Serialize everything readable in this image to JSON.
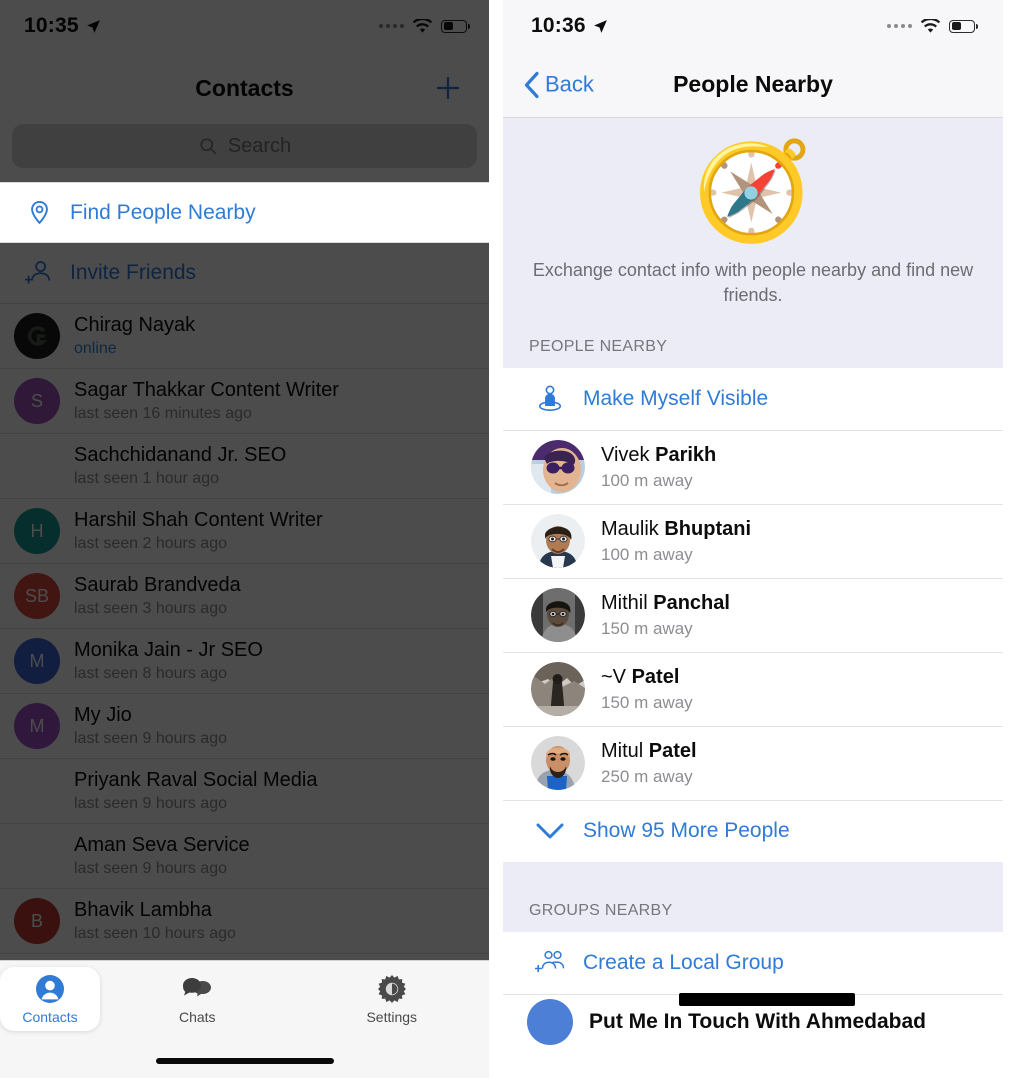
{
  "left": {
    "status": {
      "time": "10:35",
      "location_icon": "location-arrow-icon",
      "signal": "signal-dots-icon",
      "wifi": "wifi-icon",
      "battery": "battery-icon"
    },
    "nav": {
      "title": "Contacts",
      "add_button": "add-icon"
    },
    "search": {
      "placeholder": "Search",
      "icon": "search-icon"
    },
    "actions": [
      {
        "label": "Find People Nearby",
        "icon": "location-pin-icon",
        "highlighted": true
      },
      {
        "label": "Invite Friends",
        "icon": "person-add-icon",
        "highlighted": false
      }
    ],
    "contacts": [
      {
        "name": "Chirag Nayak",
        "status": "online",
        "online": true,
        "initials": "",
        "color": "#1b1b1b"
      },
      {
        "name": "Sagar Thakkar Content Writer",
        "status": "last seen 16 minutes ago",
        "online": false,
        "initials": "S",
        "color": "#a251bd"
      },
      {
        "name": "Sachchidanand Jr. SEO",
        "status": "last seen 1 hour ago",
        "online": false,
        "initials": "",
        "color": "transparent"
      },
      {
        "name": "Harshil Shah Content Writer",
        "status": "last seen 2 hours ago",
        "online": false,
        "initials": "H",
        "color": "#179a94"
      },
      {
        "name": "Saurab Brandveda",
        "status": "last seen 3 hours ago",
        "online": false,
        "initials": "SB",
        "color": "#d94a3d"
      },
      {
        "name": "Monika Jain - Jr SEO",
        "status": "last seen 8 hours ago",
        "online": false,
        "initials": "M",
        "color": "#3a64d8"
      },
      {
        "name": "My Jio",
        "status": "last seen 9 hours ago",
        "online": false,
        "initials": "M",
        "color": "#a252c9"
      },
      {
        "name": "Priyank Raval Social Media",
        "status": "last seen 9 hours ago",
        "online": false,
        "initials": "",
        "color": "transparent"
      },
      {
        "name": "Aman Seva Service",
        "status": "last seen 9 hours ago",
        "online": false,
        "initials": "",
        "color": "transparent"
      },
      {
        "name": "Bhavik Lambha",
        "status": "last seen 10 hours ago",
        "online": false,
        "initials": "B",
        "color": "#c33b30"
      }
    ],
    "tabbar": [
      {
        "label": "Contacts",
        "icon": "person-circle-icon",
        "active": true
      },
      {
        "label": "Chats",
        "icon": "chat-bubbles-icon",
        "active": false
      },
      {
        "label": "Settings",
        "icon": "gear-icon",
        "active": false
      }
    ]
  },
  "right": {
    "status": {
      "time": "10:36",
      "location_icon": "location-arrow-icon",
      "signal": "signal-dots-icon",
      "wifi": "wifi-icon",
      "battery": "battery-icon"
    },
    "nav": {
      "back_label": "Back",
      "back_icon": "chevron-left-icon",
      "title": "People Nearby"
    },
    "hero": {
      "icon": "compass-icon",
      "glyph": "🧭",
      "description": "Exchange contact info with people nearby and find new friends."
    },
    "people_section": {
      "header": "PEOPLE NEARBY",
      "visible_action": {
        "label": "Make Myself Visible",
        "icon": "person-on-platform-icon"
      },
      "people": [
        {
          "first": "Vivek ",
          "last": "Parikh",
          "distance": "100 m away",
          "avatar": "photo-vivek"
        },
        {
          "first": "Maulik ",
          "last": "Bhuptani",
          "distance": "100 m away",
          "avatar": "photo-maulik"
        },
        {
          "first": "Mithil ",
          "last": "Panchal",
          "distance": "150 m away",
          "avatar": "photo-mithil"
        },
        {
          "first": "~V ",
          "last": "Patel",
          "distance": "150 m away",
          "avatar": "photo-vpatel"
        },
        {
          "first": "Mitul ",
          "last": "Patel",
          "distance": "250 m away",
          "avatar": "photo-mitul"
        }
      ],
      "show_more": {
        "label": "Show 95 More People",
        "icon": "chevron-down-icon",
        "count": 95
      }
    },
    "groups_section": {
      "header": "GROUPS NEARBY",
      "create_action": {
        "label": "Create a Local Group",
        "icon": "group-add-icon"
      },
      "groups": [
        {
          "name": "Put Me In Touch With Ahmedabad",
          "redacted": true
        }
      ]
    }
  },
  "colors": {
    "accent": "#2f7bd6",
    "section_bg": "#ececf6",
    "dim_overlay": "#4a4a4a"
  }
}
